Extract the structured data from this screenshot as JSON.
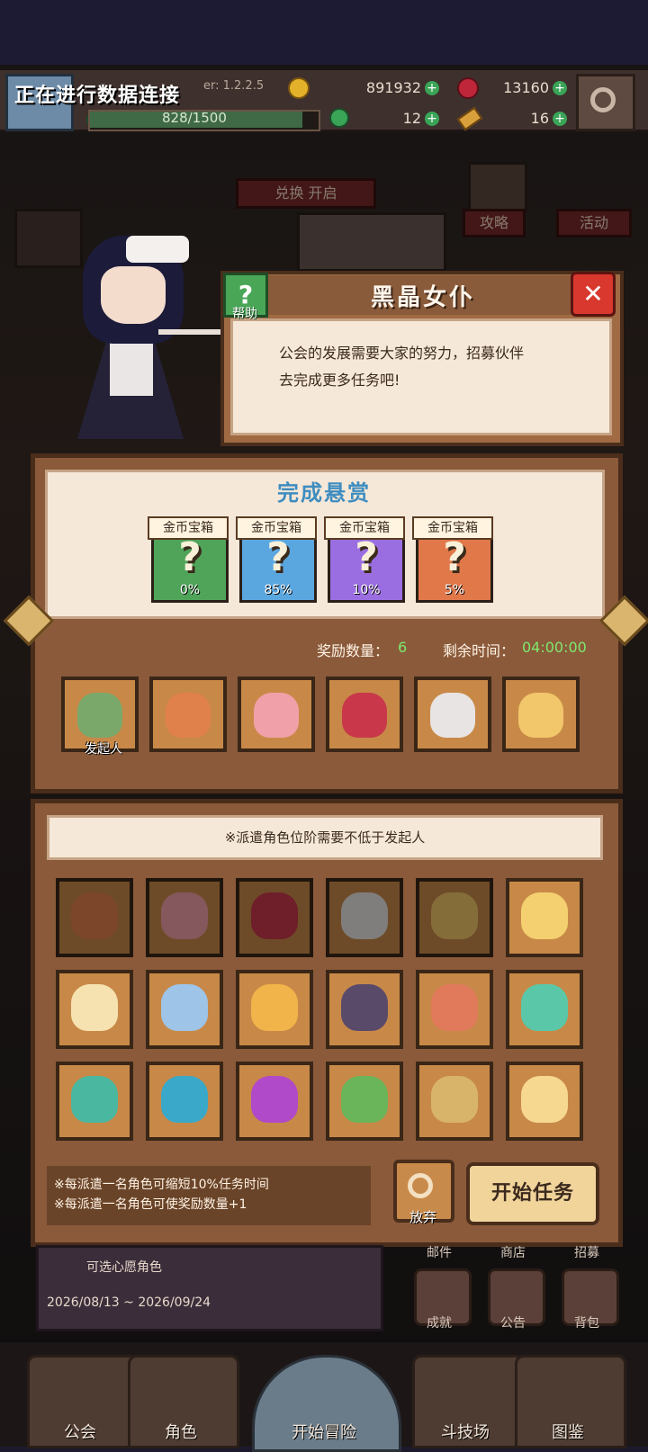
{
  "hud": {
    "connecting_text": "正在进行数据连接",
    "version": "er: 1.2.2.5",
    "xp": "828/1500",
    "gold": "891932",
    "gems": "13160",
    "clover": "12",
    "keys": "16"
  },
  "background": {
    "top_ribbon": "兑换  开启",
    "guide": "攻略",
    "events": "活动"
  },
  "dialog": {
    "title": "黑晶女仆",
    "help": "帮助",
    "help_symbol": "?",
    "close_symbol": "✕",
    "message_line1": "公会的发展需要大家的努力，招募伙伴",
    "message_line2": "去完成更多任务吧!"
  },
  "reward": {
    "title": "完成悬赏",
    "chests": [
      {
        "label": "金币宝箱",
        "symbol": "?",
        "percent": "0%",
        "color": "#4fa45a"
      },
      {
        "label": "金币宝箱",
        "symbol": "?",
        "percent": "85%",
        "color": "#5aa7e0"
      },
      {
        "label": "金币宝箱",
        "symbol": "?",
        "percent": "10%",
        "color": "#9a6ee0"
      },
      {
        "label": "金币宝箱",
        "symbol": "?",
        "percent": "5%",
        "color": "#e0784a"
      }
    ],
    "count_label": "奖励数量：",
    "count_value": "6",
    "time_label": "剩余时间：",
    "time_value": "04:00:00",
    "initiator_label": "发起人"
  },
  "dispatch": {
    "notice": "※派遣角色位阶需要不低于发起人",
    "tip1": "※每派遣一名角色可缩短10%任务时间",
    "tip2": "※每派遣一名角色可使奖励数量+1",
    "give_up": "放弃",
    "start": "开始任务"
  },
  "bottom": {
    "wish": "可选心愿角色",
    "dates": "2026/08/13 ~ 2026/09/24",
    "mail": "邮件",
    "shop": "商店",
    "recruit": "招募",
    "achievement": "成就",
    "notice": "公告",
    "bag": "背包"
  },
  "nav": {
    "guild": "公会",
    "characters": "角色",
    "adventure": "开始冒险",
    "arena": "斗技场",
    "codex": "图鉴"
  },
  "colors": {
    "panel_brown": "#8a5a3a",
    "cream": "#f6e8d8",
    "timer_green": "#7fe86e",
    "title_blue": "#3f8dc0"
  }
}
